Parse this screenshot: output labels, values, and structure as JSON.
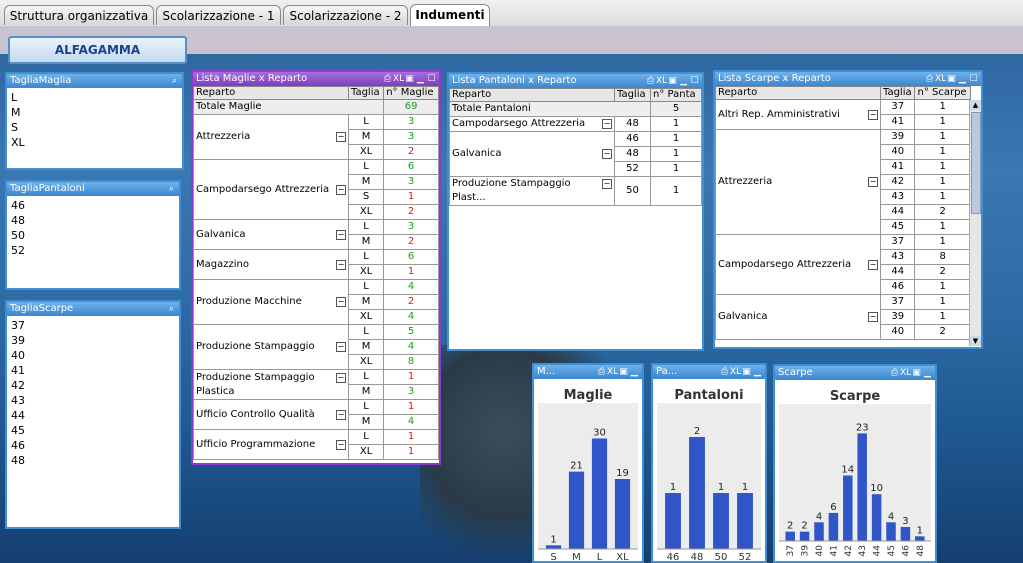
{
  "tabs": [
    "Struttura organizzativa",
    "Scolarizzazione - 1",
    "Scolarizzazione - 2",
    "Indumenti"
  ],
  "alfa_button": "ALFAGAMMA",
  "list_maglia": {
    "title": "TagliaMaglia",
    "items": [
      "L",
      "M",
      "S",
      "XL"
    ]
  },
  "list_pantaloni": {
    "title": "TagliaPantaloni",
    "items": [
      "46",
      "48",
      "50",
      "52"
    ]
  },
  "list_scarpe": {
    "title": "TagliaScarpe",
    "items": [
      "37",
      "39",
      "40",
      "41",
      "42",
      "43",
      "44",
      "45",
      "46",
      "48"
    ]
  },
  "table_maglie": {
    "title": "Lista Maglie x Reparto",
    "headers": [
      "Reparto",
      "Taglia",
      "n° Maglie"
    ],
    "total_label": "Totale Maglie",
    "total": "69",
    "groups": [
      {
        "name": "Attrezzeria",
        "rows": [
          [
            "L",
            "3",
            "g"
          ],
          [
            "M",
            "3",
            "g"
          ],
          [
            "XL",
            "2",
            "r"
          ]
        ]
      },
      {
        "name": "Campodarsego Attrezzeria",
        "rows": [
          [
            "L",
            "6",
            "g"
          ],
          [
            "M",
            "3",
            "g"
          ],
          [
            "S",
            "1",
            "r"
          ],
          [
            "XL",
            "2",
            "r"
          ]
        ]
      },
      {
        "name": "Galvanica",
        "rows": [
          [
            "L",
            "3",
            "g"
          ],
          [
            "M",
            "2",
            "r"
          ]
        ]
      },
      {
        "name": "Magazzino",
        "rows": [
          [
            "L",
            "6",
            "g"
          ],
          [
            "XL",
            "1",
            "r"
          ]
        ]
      },
      {
        "name": "Produzione Macchine",
        "rows": [
          [
            "L",
            "4",
            "g"
          ],
          [
            "M",
            "2",
            "r"
          ],
          [
            "XL",
            "4",
            "g"
          ]
        ]
      },
      {
        "name": "Produzione Stampaggio",
        "rows": [
          [
            "L",
            "5",
            "g"
          ],
          [
            "M",
            "4",
            "g"
          ],
          [
            "XL",
            "8",
            "g"
          ]
        ]
      },
      {
        "name": "Produzione Stampaggio Plastica",
        "rows": [
          [
            "L",
            "1",
            "r"
          ],
          [
            "M",
            "3",
            "g"
          ]
        ]
      },
      {
        "name": "Ufficio Controllo Qualità",
        "rows": [
          [
            "L",
            "1",
            "r"
          ],
          [
            "M",
            "4",
            "g"
          ]
        ]
      },
      {
        "name": "Ufficio Programmazione",
        "rows": [
          [
            "L",
            "1",
            "r"
          ],
          [
            "XL",
            "1",
            "r"
          ]
        ]
      }
    ]
  },
  "table_pantaloni": {
    "title": "Lista Pantaloni x Reparto",
    "headers": [
      "Reparto",
      "Taglia",
      "n° Panta"
    ],
    "total_label": "Totale Pantaloni",
    "total": "5",
    "groups": [
      {
        "name": "Campodarsego Attrezzeria",
        "rows": [
          [
            "48",
            "1"
          ]
        ]
      },
      {
        "name": "Galvanica",
        "rows": [
          [
            "46",
            "1"
          ],
          [
            "48",
            "1"
          ],
          [
            "52",
            "1"
          ]
        ]
      },
      {
        "name": "Produzione Stampaggio Plast...",
        "rows": [
          [
            "50",
            "1"
          ]
        ]
      }
    ]
  },
  "table_scarpe": {
    "title": "Lista Scarpe x Reparto",
    "headers": [
      "Reparto",
      "Taglia",
      "n° Scarpe"
    ],
    "groups": [
      {
        "name": "Altri Rep. Amministrativi",
        "rows": [
          [
            "37",
            "1"
          ],
          [
            "41",
            "1"
          ]
        ]
      },
      {
        "name": "Attrezzeria",
        "rows": [
          [
            "39",
            "1"
          ],
          [
            "40",
            "1"
          ],
          [
            "41",
            "1"
          ],
          [
            "42",
            "1"
          ],
          [
            "43",
            "1"
          ],
          [
            "44",
            "2"
          ],
          [
            "45",
            "1"
          ]
        ]
      },
      {
        "name": "Campodarsego Attrezzeria",
        "rows": [
          [
            "37",
            "1"
          ],
          [
            "43",
            "8"
          ],
          [
            "44",
            "2"
          ],
          [
            "46",
            "1"
          ]
        ]
      },
      {
        "name": "Galvanica",
        "rows": [
          [
            "37",
            "1"
          ],
          [
            "39",
            "1"
          ],
          [
            "40",
            "2"
          ]
        ]
      }
    ]
  },
  "chart_captions": {
    "maglie": "M...",
    "pantaloni": "Pa...",
    "scarpe": "Scarpe"
  },
  "chart_data": [
    {
      "type": "bar",
      "title": "Maglie",
      "categories": [
        "S",
        "M",
        "L",
        "XL"
      ],
      "values": [
        1,
        21,
        30,
        19
      ],
      "ylim": [
        0,
        38
      ],
      "color": "#2f55c8"
    },
    {
      "type": "bar",
      "title": "Pantaloni",
      "categories": [
        "46",
        "48",
        "50",
        "52"
      ],
      "values": [
        1,
        2,
        1,
        1
      ],
      "ylim": [
        0,
        2.5
      ],
      "color": "#2f55c8"
    },
    {
      "type": "bar",
      "title": "Scarpe",
      "categories": [
        "37",
        "39",
        "40",
        "41",
        "42",
        "43",
        "44",
        "45",
        "46",
        "48"
      ],
      "values": [
        2,
        2,
        4,
        6,
        14,
        23,
        10,
        4,
        3,
        1
      ],
      "ylim": [
        0,
        28
      ],
      "color": "#2f55c8"
    }
  ]
}
